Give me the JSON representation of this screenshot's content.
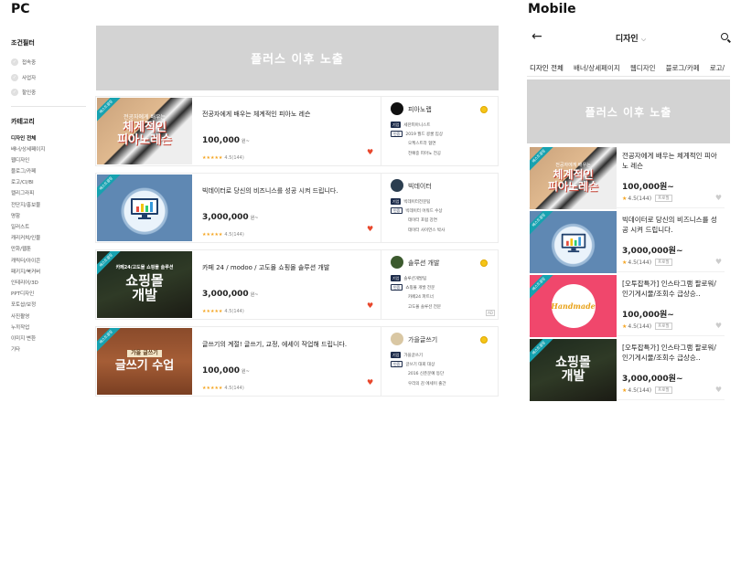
{
  "labels": {
    "pc": "PC",
    "mobile": "Mobile"
  },
  "sidebar": {
    "filter_heading": "조건필터",
    "filters": [
      "접속중",
      "사업자",
      "할인중"
    ],
    "category_heading": "카테고리",
    "categories": [
      "디자인 전체",
      "배너/상세페이지",
      "웹디자인",
      "블로그/카페",
      "로고/CI/BI",
      "캘리그라피",
      "전단지/홍보물",
      "명함",
      "일러스트",
      "캐리커쳐/인물",
      "만화/웹툰",
      "캐릭터/아이콘",
      "패키지/북커버",
      "인테리어/3D",
      "PPT디자인",
      "포토샵/보정",
      "사진촬영",
      "누끼작업",
      "이미지 변환",
      "기타"
    ]
  },
  "banner_text": "플러스 이후 노출",
  "pc_cards": [
    {
      "ribbon": "베스트셀링",
      "thumb_line1": "전공자에게 배우는",
      "thumb_line2": "체계적인",
      "thumb_line3": "피아노레슨",
      "title": "전공자에게 배우는 체계적인 피아노 레슨",
      "price": "100,000",
      "unit": "원~",
      "stars": "★★★★★",
      "rating": "4.5(144)",
      "seller": "피아노랩",
      "tag1": "기업",
      "line1": "세잔피아니스트",
      "line2": "2019 월드 콩쿨 입상",
      "tag2": "인증",
      "line3": "오케스트라 협연",
      "line4": "전예중 피아노 전공",
      "badge": ""
    },
    {
      "ribbon": "베스트셀링",
      "thumb_line1": "",
      "thumb_line2": "",
      "thumb_line3": "",
      "title": "빅데이터로 당신의 비즈니스를 성공 시켜 드립니다.",
      "price": "3,000,000",
      "unit": "원~",
      "stars": "★★★★★",
      "rating": "4.5(144)",
      "seller": "빅데이터",
      "tag1": "기업",
      "line1": "빅데이터전문팀",
      "line2": "빅데이터 어워드 수상",
      "tag2": "인증",
      "line3": "데이터 포럼 강연",
      "line4": "데이터 사이언스 박사",
      "badge": ""
    },
    {
      "ribbon": "베스트셀링",
      "thumb_line1": "카페24/고도몰 쇼핑몰 솔루션",
      "thumb_line2": "쇼핑몰",
      "thumb_line3": "개발",
      "title": "카페 24 / modoo / 고도몰 쇼핑몰 솔루션 개발",
      "price": "3,000,000",
      "unit": "원~",
      "stars": "★★★★★",
      "rating": "4.5(144)",
      "seller": "솔루션 개발",
      "tag1": "기업",
      "line1": "솔루션개발팀",
      "line2": "쇼핑몰 개발 전문",
      "tag2": "인증",
      "line3": "카페24 파트너",
      "line4": "고도몰 솔루션 전문",
      "badge": "AD"
    },
    {
      "ribbon": "베스트셀링",
      "thumb_line1": "가을 글쓰기",
      "thumb_line2": "글쓰기 수업",
      "thumb_line3": "",
      "title": "글쓰기의 계절! 글쓰기, 교정, 에세이 작업해 드립니다.",
      "price": "100,000",
      "unit": "원~",
      "stars": "★★★★★",
      "rating": "4.5(144)",
      "seller": "가을글쓰기",
      "tag1": "기업",
      "line1": "가을글쓰기",
      "line2": "글쓰기 대회 대상",
      "tag2": "인증",
      "line3": "2016 신춘문예 등단",
      "line4": "우리의 감 에세이 출간",
      "badge": ""
    }
  ],
  "mobile": {
    "back_icon": "←",
    "title": "디자인",
    "chevron": "⌵",
    "tabs": [
      "디자인 전체",
      "배너/상세페이지",
      "웹디자인",
      "블로그/카페",
      "로고/"
    ],
    "cards": [
      {
        "ribbon": "베스트셀링",
        "thumb_line1": "전공자에게 배우는",
        "thumb_line2": "체계적인",
        "thumb_line3": "피아노레슨",
        "title": "전공자에게 배우는 체계적인 피아노 레슨",
        "price": "100,000원~",
        "rating": "4.5(144)",
        "pro": "프로필"
      },
      {
        "ribbon": "베스트셀링",
        "thumb_line1": "",
        "thumb_line2": "",
        "thumb_line3": "",
        "title": "빅데이터로 당신의 비즈니스를 성공 시켜 드립니다.",
        "price": "3,000,000원~",
        "rating": "4.5(144)",
        "pro": "프로필"
      },
      {
        "ribbon": "베스트셀링",
        "thumb_line1": "",
        "thumb_line2": "Handmade",
        "thumb_line3": "",
        "title": "[오투잡특가] 인스타그램 팔로워/인기게시물/조회수 급상승..",
        "price": "100,000원~",
        "rating": "4.5(144)",
        "pro": "프로필"
      },
      {
        "ribbon": "베스트셀링",
        "thumb_line1": "",
        "thumb_line2": "쇼핑몰",
        "thumb_line3": "개발",
        "title": "[오투잡특가] 인스타그램 팔로워/인기게시물/조회수 급상승..",
        "price": "3,000,000원~",
        "rating": "4.5(144)",
        "pro": "프로필"
      }
    ]
  },
  "colors": {
    "accent": "#f26522",
    "ribbon": "#17a2b0",
    "banner": "#d3d3d3",
    "tag": "#1b2a49"
  }
}
